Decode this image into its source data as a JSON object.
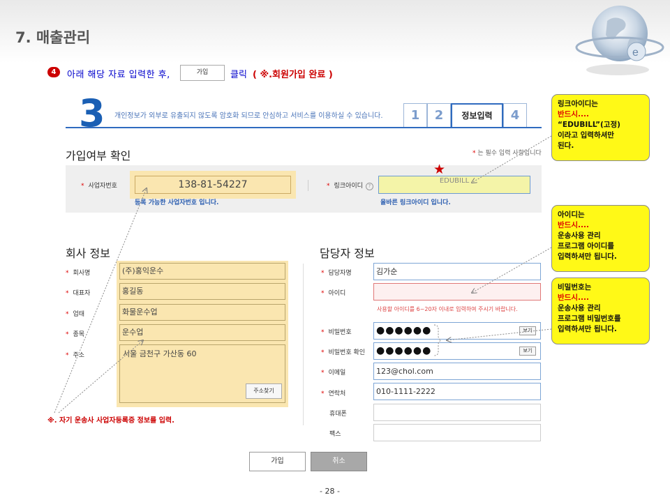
{
  "slide": {
    "title": "7. 매출관리",
    "page_number": "- 28 -"
  },
  "instruction": {
    "step": "4",
    "text_before": "아래 해당 자료 입력한 후,",
    "button_label": "가입",
    "text_after": "클릭",
    "note": "( ※.회원가입 완료 )"
  },
  "form_header": {
    "step_big": "3",
    "notice": "개인정보가 외부로 유출되지 않도록 암호화 되므로 안심하고 서비스를 이용하실 수 있습니다.",
    "tabs": [
      "1",
      "2",
      "정보입력",
      "4"
    ]
  },
  "check_section": {
    "title": "가입여부 확인",
    "required_note": "는 필수 입력 사항입니다",
    "biz_label": "사업자번호",
    "biz_value": "138-81-54227",
    "biz_msg": "등록 가능한 사업자번호 입니다.",
    "link_label": "링크아이디",
    "link_value": "EDUBILL",
    "link_msg": "올바른 링크아이디 입니다."
  },
  "company": {
    "title": "회사 정보",
    "fields": [
      {
        "label": "회사명",
        "value": "(주)홍익운수"
      },
      {
        "label": "대표자",
        "value": "홍길동"
      },
      {
        "label": "업태",
        "value": "화물운수업"
      },
      {
        "label": "종목",
        "value": "운수업"
      },
      {
        "label": "주소",
        "value": "서울 금천구 가산동 60"
      }
    ],
    "address_button": "주소찾기"
  },
  "person": {
    "title": "담당자 정보",
    "name_label": "담당자명",
    "name_value": "김가순",
    "id_label": "아이디",
    "id_value": "",
    "id_error": "사용할 아이디를 6~20자 이내로 입력하여 주시기 바랍니다.",
    "pw_label": "비밀번호",
    "pw_value": "●●●●●●",
    "pw_confirm_label": "비밀번호 확인",
    "pw_confirm_value": "●●●●●●",
    "view_label": "보기",
    "email_label": "이메일",
    "email_value": "123@chol.com",
    "phone_label": "연락처",
    "phone_value": "010-1111-2222",
    "mobile_label": "휴대폰",
    "mobile_value": "",
    "fax_label": "팩스",
    "fax_value": ""
  },
  "buttons": {
    "join": "가입",
    "cancel": "취소"
  },
  "callouts": {
    "link": {
      "line1": "링크아이디는",
      "line2": "반드시....",
      "line3": "“EDUBILL”(고정)",
      "line4": "이라고 입력하셔만",
      "line5": "된다."
    },
    "id": {
      "line1": "아이디는",
      "line2": "반드시....",
      "line3": "운송사용 관리",
      "line4": "프로그램 아이디를",
      "line5": "입력하셔만 됩니다."
    },
    "pw": {
      "line1": "비밀번호는",
      "line2": "반드시....",
      "line3": "운송사용 관리",
      "line4": "프로그램 비밀번호를",
      "line5": "입력하셔만 됩니다."
    },
    "company_note": "※. 자기 운송사 사업자등록증 정보를 입력."
  },
  "colors": {
    "accent_blue": "#2f6bbf",
    "callout_yellow": "#fff917",
    "field_yellow": "#fae6b0",
    "required_red": "#d00000"
  }
}
